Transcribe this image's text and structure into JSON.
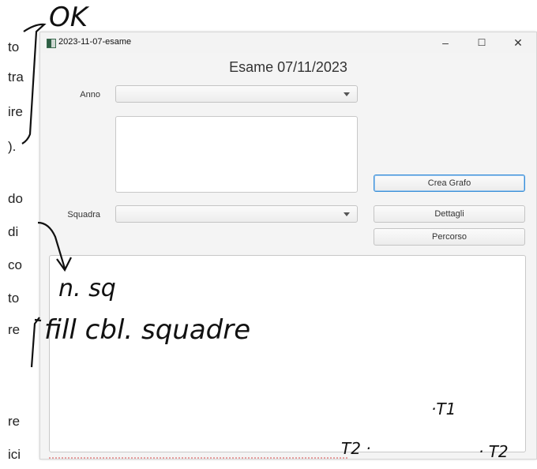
{
  "background_text": [
    "to",
    "tra",
    "ire",
    ").",
    "do",
    "di",
    "co",
    "to",
    "re",
    "re",
    "ici"
  ],
  "window": {
    "title": "2023-11-07-esame",
    "minimize_glyph": "–",
    "maximize_glyph": "☐",
    "close_glyph": "✕"
  },
  "header": {
    "title": "Esame 07/11/2023"
  },
  "form": {
    "anno_label": "Anno",
    "anno_value": "",
    "squadra_label": "Squadra",
    "squadra_value": "",
    "text_area_value": ""
  },
  "buttons": {
    "crea_grafo": "Crea Grafo",
    "dettagli": "Dettagli",
    "percorso": "Percorso"
  },
  "output": {
    "text": ""
  },
  "annotations": {
    "ok": "OK",
    "n_sq": "n. sq",
    "fill": "fill cbl. squadre",
    "t1": "·T1",
    "t2_left": "T2 ·",
    "t2_right": "· T2"
  },
  "icons": [
    "app-icon",
    "dropdown-arrow-icon"
  ],
  "colors": {
    "focus_border": "#3a8fd8",
    "window_bg": "#f4f4f4"
  }
}
